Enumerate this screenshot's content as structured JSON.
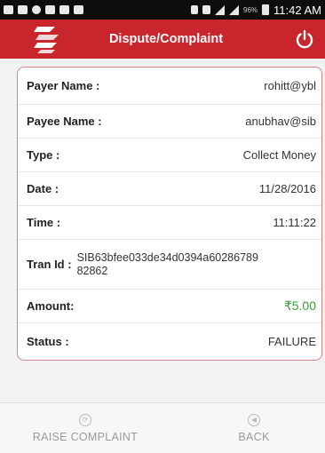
{
  "status_bar": {
    "battery_pct": "96%",
    "time": "11:42 AM"
  },
  "app_bar": {
    "title": "Dispute/Complaint",
    "logo_icon": "app-logo-icon",
    "power_icon": "power-icon",
    "colors": {
      "background": "#c9252c",
      "text": "#ffffff"
    }
  },
  "details": [
    {
      "label": "Payer Name :",
      "value": "rohitt@ybl"
    },
    {
      "label": "Payee Name :",
      "value": "anubhav@sib"
    },
    {
      "label": "Type :",
      "value": "Collect Money"
    },
    {
      "label": "Date :",
      "value": "11/28/2016"
    },
    {
      "label": "Time :",
      "value": "11:11:22"
    },
    {
      "label": "Tran Id :",
      "value": "SIB63bfee033de34d0394a6028678982862"
    },
    {
      "label": "Amount:",
      "value": "₹5.00"
    },
    {
      "label": "Status :",
      "value": "FAILURE"
    }
  ],
  "colors": {
    "card_border": "#d9838a",
    "amount": "#3a9a3a"
  },
  "bottom_bar": {
    "raise_label": "RAISE COMPLAINT",
    "raise_icon": "raise-complaint-icon",
    "back_label": "BACK",
    "back_icon": "back-arrow-icon"
  }
}
